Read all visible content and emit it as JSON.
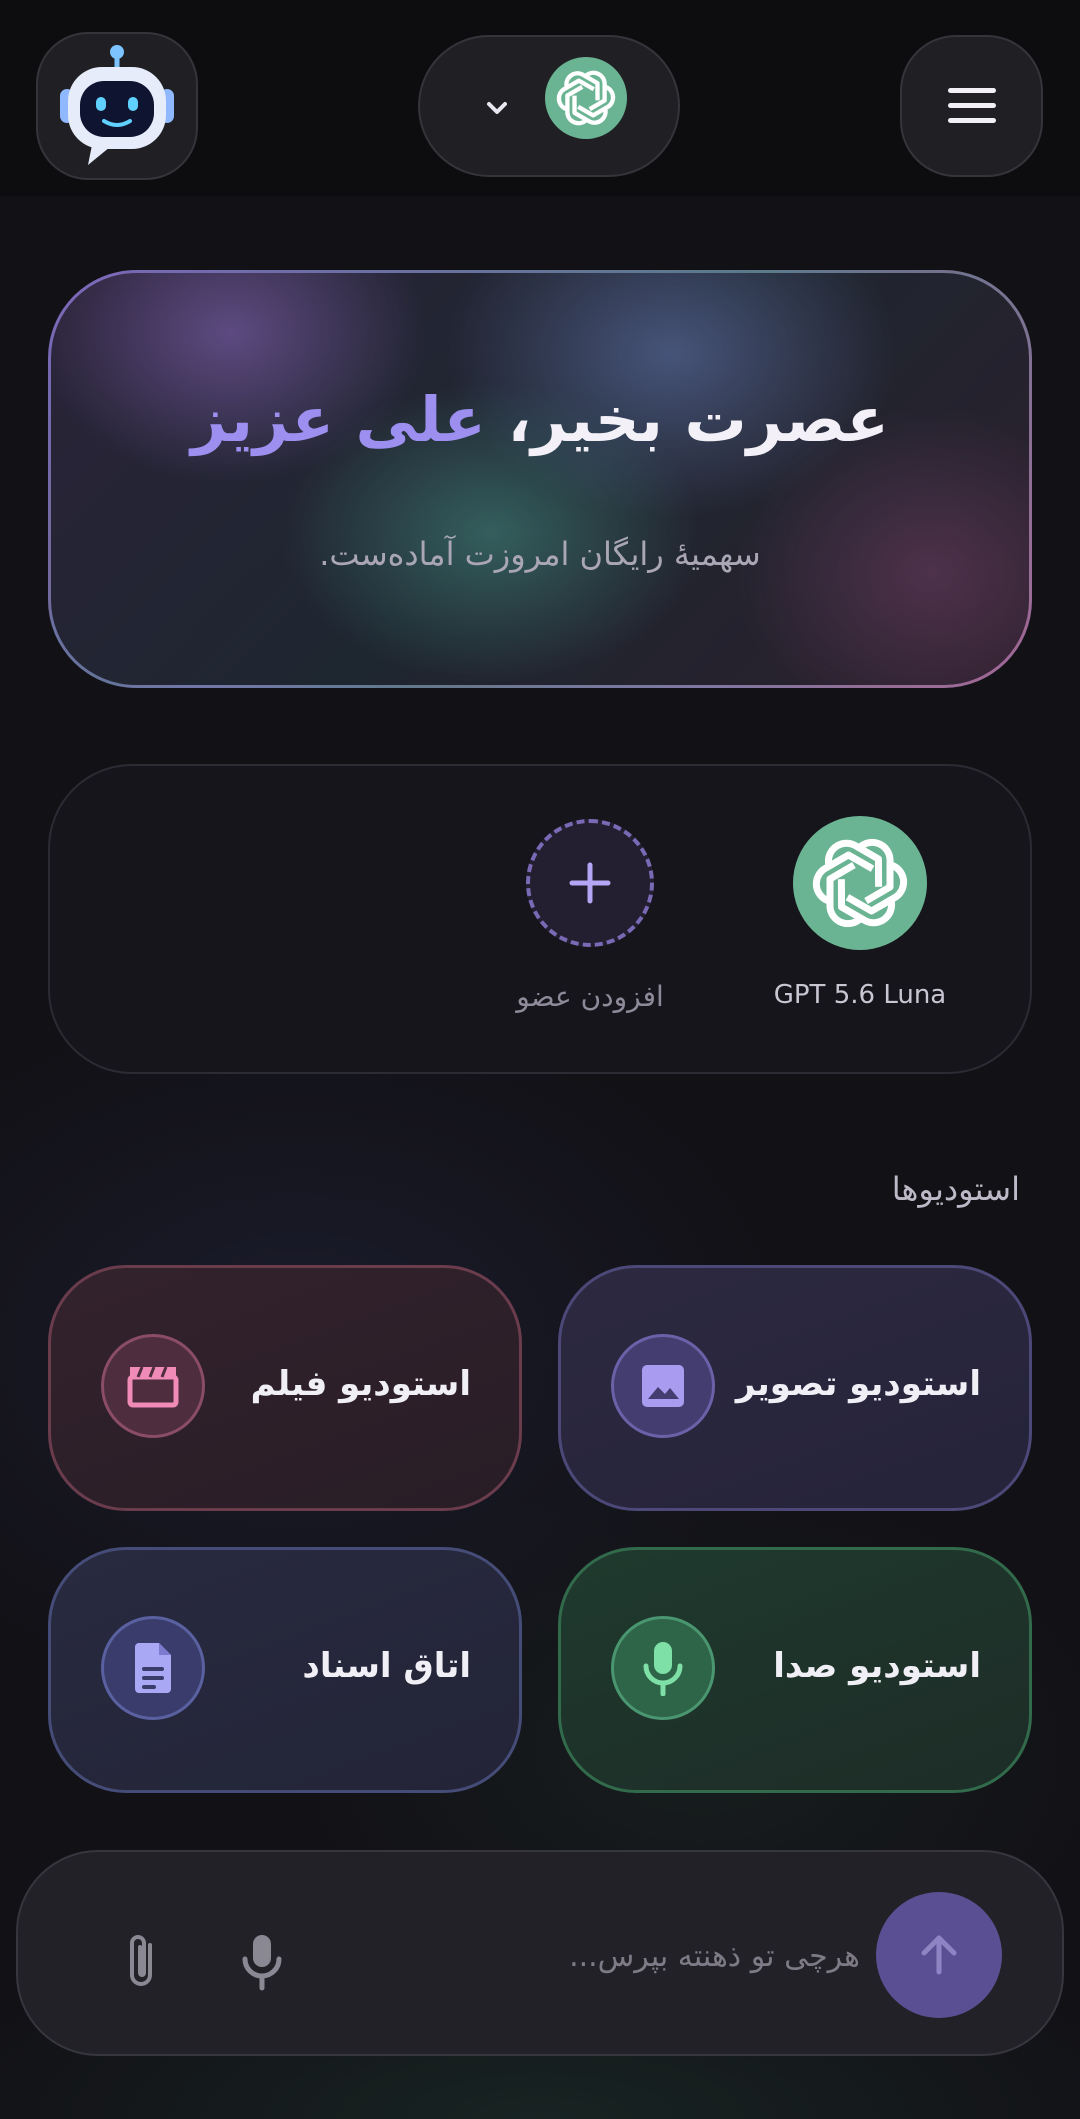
{
  "header": {
    "avatar_icon": "robot-icon",
    "model_icon": "openai-logo-icon",
    "model_chevron_icon": "chevron-down-icon",
    "menu_icon": "hamburger-menu-icon"
  },
  "hero": {
    "greeting": "عصرت بخیر،",
    "name": "علی عزیز",
    "subtitle": "سهمیهٔ رایگان امروزت آماده‌ست."
  },
  "members": {
    "items": [
      {
        "label": "GPT 5.6 Luna",
        "icon": "openai-logo-icon"
      }
    ],
    "add_label": "افزودن عضو",
    "add_icon": "plus-icon"
  },
  "studios": {
    "title": "استودیوها",
    "items": [
      {
        "label": "استودیو تصویر",
        "icon": "image-icon",
        "accent": "#a99cf0"
      },
      {
        "label": "استودیو فیلم",
        "icon": "clapperboard-icon",
        "accent": "#f08ab6"
      },
      {
        "label": "استودیو صدا",
        "icon": "microphone-icon",
        "accent": "#7ee0a6"
      },
      {
        "label": "اتاق اسناد",
        "icon": "document-icon",
        "accent": "#a9a8f5"
      }
    ]
  },
  "composer": {
    "placeholder": "هرچی تو ذهنته بپرس...",
    "send_icon": "arrow-up-icon",
    "mic_icon": "microphone-icon",
    "attach_icon": "paperclip-icon"
  },
  "colors": {
    "background": "#121116",
    "accent": "#9d8ff0",
    "send_button": "#5b4f93",
    "openai_green": "#6ab493"
  }
}
